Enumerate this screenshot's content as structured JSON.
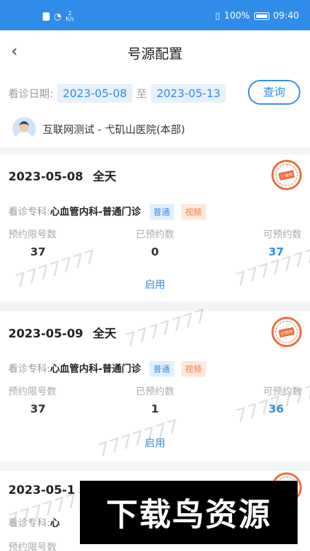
{
  "status_bar": {
    "network_speed": "2\nK/s",
    "battery": "100%",
    "time": "09:40"
  },
  "nav": {
    "title": "号源配置"
  },
  "filter": {
    "date_label": "看诊日期:",
    "start_date": "2023-05-08",
    "separator": "至",
    "end_date": "2023-05-13",
    "query_label": "查询"
  },
  "doctor": {
    "hospital_text": "互联网测试 - 弋矶山医院(本部)"
  },
  "labels": {
    "dept_label": "看诊专科:",
    "limit_label": "预约限号数",
    "booked_label": "已预约数",
    "available_label": "可预约数",
    "enable_label": "启用",
    "stamp_text": "已预停"
  },
  "schedules": [
    {
      "date": "2023-05-08",
      "period": "全天",
      "dept": "心血管内科-普通门诊",
      "tag1": "普通",
      "tag2": "视频",
      "limit": "37",
      "booked": "0",
      "available": "37"
    },
    {
      "date": "2023-05-09",
      "period": "全天",
      "dept": "心血管内科-普通门诊",
      "tag1": "普通",
      "tag2": "视频",
      "limit": "37",
      "booked": "1",
      "available": "36"
    },
    {
      "date": "2023-05-1",
      "period": "",
      "dept": "心",
      "tag1": "",
      "tag2": "",
      "limit_label": "预约限号数"
    }
  ],
  "watermark_text": "7777777",
  "overlay_text": "下载鸟资源",
  "colors": {
    "primary": "#2f8ce8",
    "stamp": "#ee6a3a",
    "tag_orange": "#ee7a3a"
  }
}
